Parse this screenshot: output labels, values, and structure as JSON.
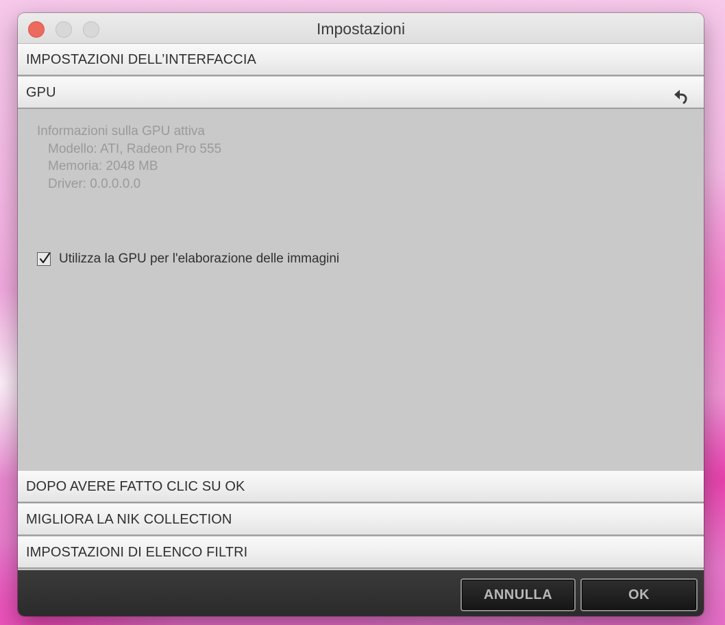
{
  "window": {
    "title": "Impostazioni"
  },
  "sections": {
    "interface": "IMPOSTAZIONI DELL’INTERFACCIA",
    "gpu": "GPU",
    "after_ok": "DOPO AVERE FATTO CLIC SU OK",
    "improve": "MIGLIORA LA NIK COLLECTION",
    "filter_list": "IMPOSTAZIONI DI ELENCO FILTRI"
  },
  "gpu": {
    "info_title": "Informazioni sulla GPU attiva",
    "model": "Modello: ATI, Radeon Pro 555",
    "memory": "Memoria: 2048 MB",
    "driver": "Driver: 0.0.0.0.0",
    "use_gpu_label": "Utilizza la GPU per l'elaborazione delle immagini",
    "use_gpu_checked": true
  },
  "buttons": {
    "cancel": "ANNULLA",
    "ok": "OK"
  },
  "icons": {
    "reset": "undo-arrow-icon",
    "checkmark": "checkmark-icon",
    "close": "close-icon",
    "minimize": "minimize-icon",
    "zoom": "zoom-icon"
  },
  "colors": {
    "close_button": "#ec6a5e",
    "panel_background": "#c9c9c9",
    "bottom_bar": "#2b2b2b"
  }
}
